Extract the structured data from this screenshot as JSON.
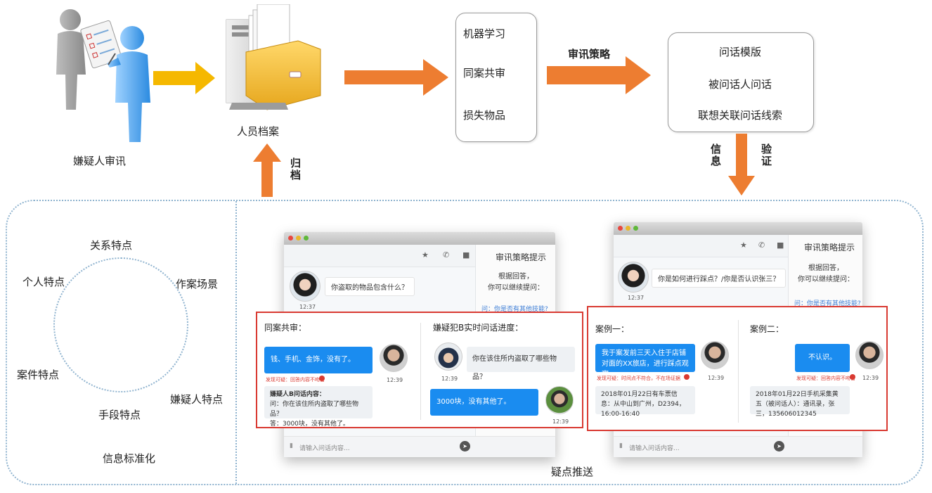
{
  "top_flow": {
    "suspect_label": "嫌疑人审讯",
    "archive_label": "人员档案",
    "archive_arrow_label": "归档",
    "ml_box": [
      "机器学习",
      "同案共审",
      "损失物品"
    ],
    "strategy_arrow_label": "审讯策略",
    "strategy_box": [
      "问话模版",
      "被问话人问话",
      "联想关联问话线索"
    ],
    "info_label": "信息",
    "verify_label": "验证"
  },
  "left_panel": {
    "features": [
      "关系特点",
      "个人特点",
      "作案场景",
      "案件特点",
      "嫌疑人特点",
      "手段特点"
    ],
    "bottom_label": "信息标准化"
  },
  "bottom_caption": "疑点推送",
  "chat_windows": [
    {
      "side_title": "审讯策略提示",
      "side_text": "根据回答，\n你可以继续提问：",
      "side_link": "问：你是否有其他技能?",
      "question": "你盗取的物品包含什么？",
      "question_time": "12:37",
      "input_placeholder": "请输入问话内容...",
      "panel": {
        "left_title": "同案共审：",
        "left_bubble": "钱、手机、金饰，没有了。",
        "left_time": "12:39",
        "left_warning": "发现可疑：回答内容不吻合",
        "left_record_title": "嫌疑人B问话内容：",
        "left_record_q": "问：你在该住所内盗取了哪些物品？",
        "left_record_a": "答：3000块，没有其他了。",
        "right_title": "嫌疑犯B实时问话进度：",
        "right_question": "你在该住所内盗取了哪些物品？",
        "right_q_time": "12:39",
        "right_answer": "3000块，没有其他了。",
        "right_a_time": "12:39"
      }
    },
    {
      "side_title": "审讯策略提示",
      "side_text": "根据回答，\n你可以继续提问：",
      "side_link": "问：你是否有其他技能?",
      "question": "你是如何进行踩点？/你是否认识张三？",
      "question_time": "12:37",
      "input_placeholder": "请输入问话内容...",
      "panel": {
        "left_title": "案例一：",
        "left_bubble": "我于案发前三天入住于店铺对面的XX旅店，进行踩点观察。",
        "left_time": "12:39",
        "left_warning": "发现可疑：时间点不符合，不在场证据",
        "left_record": "2018年01月22日有车票信息：从中山到广州，D2394，16:00-16:40",
        "right_title": "案例二：",
        "right_bubble": "不认识。",
        "right_time": "12:39",
        "right_warning": "发现可疑：回答内容不吻合",
        "right_record": "2018年01月22日手机采集黄五（被问话人）：通讯录，张三，135606012345"
      }
    }
  ],
  "colors": {
    "arrow_orange": "#ed7d31",
    "arrow_yellow": "#f5b800",
    "dotted_blue": "#8fb3cf",
    "highlight_red": "#d93a32",
    "bubble_blue": "#1a8cf0"
  }
}
